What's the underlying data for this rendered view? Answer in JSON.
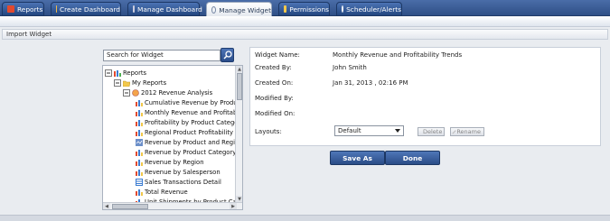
{
  "tabs": [
    {
      "label": "Reports",
      "icon": "reports-icon",
      "color": "#e24a2f"
    },
    {
      "label": "Create Dashboard",
      "icon": "create-dashboard-icon",
      "color": "#f0b84a"
    },
    {
      "label": "Manage Dashboard",
      "icon": "manage-dashboard-icon",
      "color": "#ffffff"
    },
    {
      "label": "Manage Widget",
      "icon": "manage-widget-icon",
      "color": "#7a8aa6",
      "active": true
    },
    {
      "label": "Permissions",
      "icon": "lock-icon",
      "color": "#f2c84b"
    },
    {
      "label": "Scheduler/Alerts",
      "icon": "scheduler-icon",
      "color": "#ffffff"
    }
  ],
  "section": {
    "title": "Import Widget"
  },
  "search": {
    "placeholder": "Search for Widget",
    "value": "Search for Widget"
  },
  "tree": {
    "root": "Reports",
    "my_reports": "My Reports",
    "folder": "2012 Revenue Analysis",
    "items": [
      "Cumulative Revenue by Product",
      "Monthly Revenue and Profitability",
      "Profitability by Product Category",
      "Regional Product Profitability",
      "Revenue by Product and Region",
      "Revenue by Product Category",
      "Revenue by Region",
      "Revenue by Salesperson",
      "Sales Transactions Detail",
      "Total Revenue",
      "Unit Shipments by Product Categ"
    ]
  },
  "details": {
    "widget_name_label": "Widget Name:",
    "widget_name": "Monthly Revenue and Profitability Trends",
    "created_by_label": "Created By:",
    "created_by": "John Smith",
    "created_on_label": "Created On:",
    "created_on": "Jan 31,  2013 ,  02:16 PM",
    "modified_by_label": "Modified By:",
    "modified_on_label": "Modified On:",
    "layouts_label": "Layouts:",
    "layout_selected": "Default",
    "delete_label": "Delete",
    "rename_label": "Rename"
  },
  "actions": {
    "save_as": "Save As",
    "done": "Done"
  }
}
